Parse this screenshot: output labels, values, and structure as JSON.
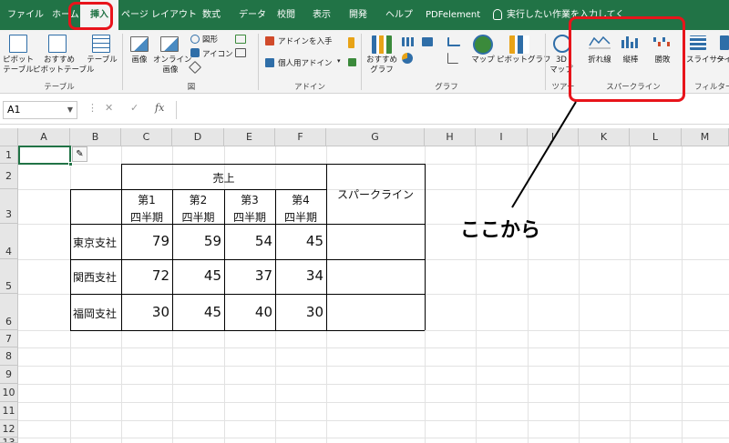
{
  "ribbon_tabs": [
    {
      "label": "ファイル"
    },
    {
      "label": "ホーム"
    },
    {
      "label": "挿入"
    },
    {
      "label": "ページ レイアウト"
    },
    {
      "label": "数式"
    },
    {
      "label": "データ"
    },
    {
      "label": "校閲"
    },
    {
      "label": "表示"
    },
    {
      "label": "開発"
    },
    {
      "label": "ヘルプ"
    },
    {
      "label": "PDFelement"
    }
  ],
  "tell_me": "実行したい作業を入力してください",
  "ribbon": {
    "tables": {
      "pivot": "ピボット\nテーブル",
      "recommended_pivot": "おすすめ\nピボットテーブル",
      "table": "テーブル",
      "group": "テーブル"
    },
    "illustrations": {
      "picture": "画像",
      "online_picture": "オンライン\n画像",
      "shapes": "図形",
      "icons": "アイコン",
      "group": "図"
    },
    "addins": {
      "get_addins": "アドインを入手",
      "my_addins": "個人用アドイン",
      "group": "アドイン"
    },
    "charts": {
      "recommended": "おすすめ\nグラフ",
      "map": "マップ",
      "pivotchart": "ピボットグラフ",
      "group": "グラフ"
    },
    "tours": {
      "map3d": "3D\nマップ",
      "group": "ツアー"
    },
    "sparklines": {
      "line": "折れ線",
      "column": "縦棒",
      "winloss": "勝敗",
      "group": "スパークライン"
    },
    "filters": {
      "slicer": "スライサー",
      "timeline": "タイ",
      "group": "フィルター"
    }
  },
  "formula_bar": {
    "name_box": "A1",
    "fx": "fx",
    "formula": ""
  },
  "columns": [
    "A",
    "B",
    "C",
    "D",
    "E",
    "F",
    "G",
    "H",
    "I",
    "J",
    "K",
    "L",
    "M"
  ],
  "rows": [
    "1",
    "2",
    "3",
    "4",
    "5",
    "6",
    "7",
    "8",
    "9",
    "10",
    "11",
    "12",
    "13"
  ],
  "table": {
    "sales_header": "売上",
    "quarters": [
      {
        "line1": "第1",
        "line2": "四半期"
      },
      {
        "line1": "第2",
        "line2": "四半期"
      },
      {
        "line1": "第3",
        "line2": "四半期"
      },
      {
        "line1": "第4",
        "line2": "四半期"
      }
    ],
    "sparkline_header": "スパークライン",
    "rows": [
      {
        "branch": "東京支社",
        "values": [
          79,
          59,
          54,
          45
        ]
      },
      {
        "branch": "関西支社",
        "values": [
          72,
          45,
          37,
          34
        ]
      },
      {
        "branch": "福岡支社",
        "values": [
          30,
          45,
          40,
          30
        ]
      }
    ]
  },
  "callout_text": "ここから",
  "colors": {
    "ribbon_green": "#217346",
    "highlight_red": "#e8141b"
  }
}
